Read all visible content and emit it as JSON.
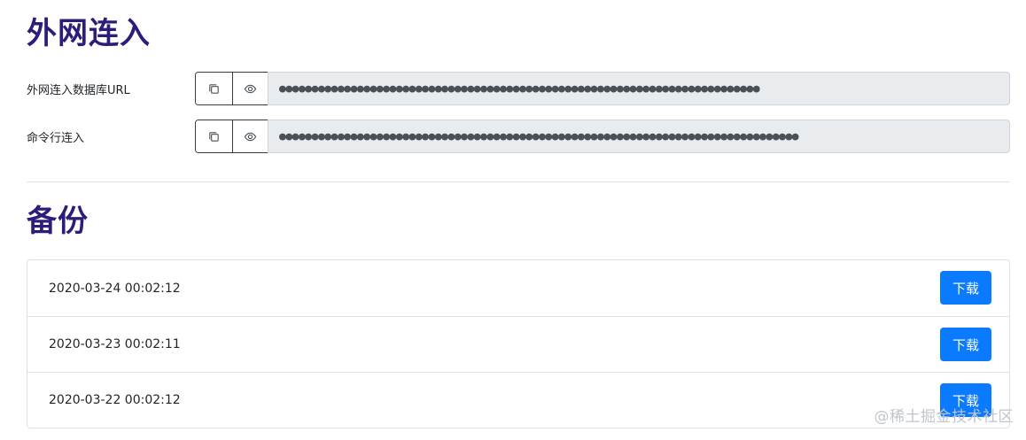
{
  "external_access": {
    "title": "外网连入",
    "fields": [
      {
        "label": "外网连入数据库URL",
        "masked_value": "●●●●●●●●●●●●●●●●●●●●●●●●●●●●●●●●●●●●●●●●●●●●●●●●●●●●●●●●●●●●●●●●●●●●●●●●●●"
      },
      {
        "label": "命令行连入",
        "masked_value": "●●●●●●●●●●●●●●●●●●●●●●●●●●●●●●●●●●●●●●●●●●●●●●●●●●●●●●●●●●●●●●●●●●●●●●●●●●●●●●●●"
      }
    ]
  },
  "backup": {
    "title": "备份",
    "download_label": "下载",
    "items": [
      {
        "timestamp": "2020-03-24 00:02:12"
      },
      {
        "timestamp": "2020-03-23 00:02:11"
      },
      {
        "timestamp": "2020-03-22 00:02:12"
      }
    ]
  },
  "icons": {
    "copy": "copy-icon",
    "reveal": "eye-icon"
  },
  "colors": {
    "heading": "#2b1d7a",
    "primary_button": "#0a7bff",
    "input_bg": "#e9ecef"
  },
  "watermark": "@稀土掘金技术社区"
}
